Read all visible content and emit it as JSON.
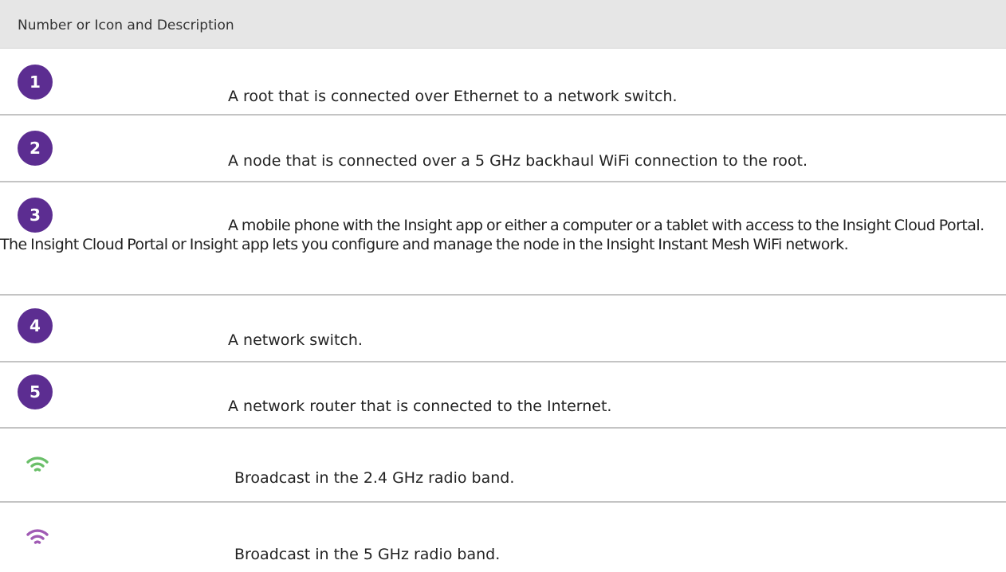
{
  "header": {
    "label": "Number or Icon and Description"
  },
  "colors": {
    "badge": "#5c2d91",
    "wifi_24": "#6abf69",
    "wifi_5": "#a05ab4",
    "header_bg": "#e6e6e6",
    "divider": "#c4c4c4"
  },
  "rows": [
    {
      "icon": "number-badge",
      "number": "1",
      "description": "A root that is connected over Ethernet to a network switch."
    },
    {
      "icon": "number-badge",
      "number": "2",
      "description": "A node that is connected over a 5 GHz backhaul WiFi connection to the root."
    },
    {
      "icon": "number-badge",
      "number": "3",
      "description": "A mobile phone with the Insight app or either a computer or a tablet with access to the Insight Cloud Portal. The Insight Cloud Portal or Insight app lets you configure and manage the node in the Insight Instant Mesh WiFi network."
    },
    {
      "icon": "number-badge",
      "number": "4",
      "description": "A network switch."
    },
    {
      "icon": "number-badge",
      "number": "5",
      "description": "A network router that is connected to the Internet."
    },
    {
      "icon": "wifi-green-icon",
      "description": "Broadcast in the 2.4 GHz radio band."
    },
    {
      "icon": "wifi-purple-icon",
      "description": "Broadcast in the 5 GHz radio band."
    }
  ]
}
